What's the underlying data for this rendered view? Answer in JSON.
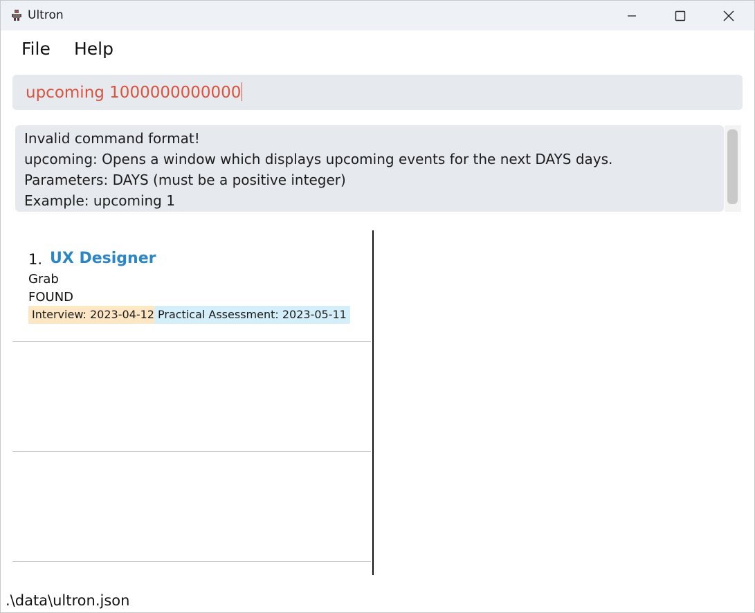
{
  "window": {
    "title": "Ultron"
  },
  "menu": {
    "file_label": "File",
    "help_label": "Help"
  },
  "command": {
    "value": "upcoming 1000000000000"
  },
  "result": {
    "lines": [
      "Invalid command format!",
      "upcoming: Opens a window which displays upcoming events for the next DAYS days.",
      "Parameters: DAYS (must be a positive integer)",
      "Example: upcoming 1"
    ]
  },
  "openings": [
    {
      "index": "1.",
      "title": "UX Designer",
      "company": "Grab",
      "status": "FOUND",
      "tags": [
        "Interview: 2023-04-12",
        "Practical Assessment: 2023-05-11"
      ]
    }
  ],
  "status_bar": {
    "path": ".\\data\\ultron.json"
  },
  "colors": {
    "command_text": "#d9533d",
    "title_accent": "#2c86c4",
    "interview_tag": "#fde6c3",
    "assessment_tag": "#d4eefa"
  }
}
